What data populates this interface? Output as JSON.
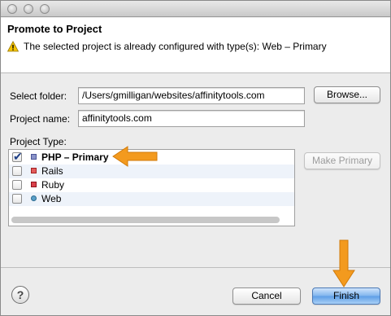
{
  "header": {
    "title": "Promote to Project",
    "message": "The selected project is already configured with type(s): Web – Primary"
  },
  "folder": {
    "label": "Select folder:",
    "value": "/Users/gmilligan/websites/affinitytools.com",
    "browse_label": "Browse..."
  },
  "project_name": {
    "label": "Project name:",
    "value": "affinitytools.com"
  },
  "project_type": {
    "label": "Project Type:",
    "make_primary_label": "Make Primary",
    "items": [
      {
        "label": "PHP – Primary",
        "checked": true,
        "icon": "php-nature-icon"
      },
      {
        "label": "Rails",
        "checked": false,
        "icon": "rails-nature-icon"
      },
      {
        "label": "Ruby",
        "checked": false,
        "icon": "ruby-nature-icon"
      },
      {
        "label": "Web",
        "checked": false,
        "icon": "web-nature-icon"
      }
    ]
  },
  "footer": {
    "help_label": "?",
    "cancel_label": "Cancel",
    "finish_label": "Finish"
  },
  "colors": {
    "annotation_arrow": "#f39a1e",
    "default_button": "#5c9de6"
  }
}
